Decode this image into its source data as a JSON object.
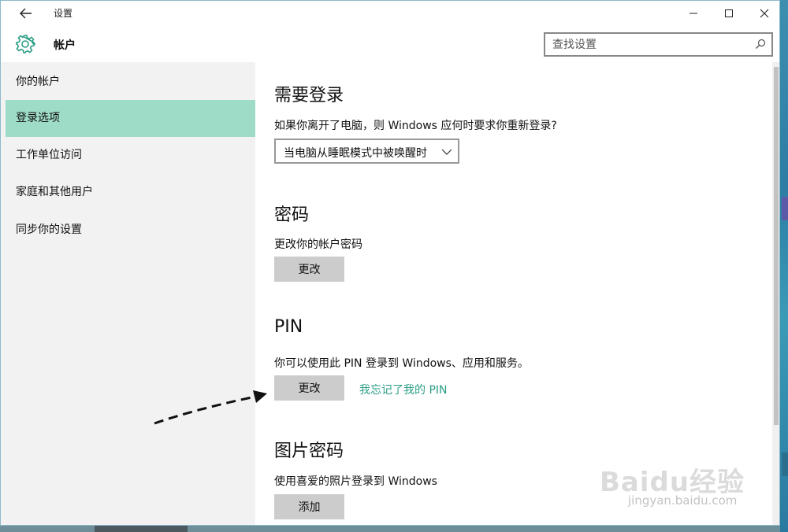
{
  "window": {
    "title": "设置",
    "section": "帐户",
    "search_placeholder": "查找设置"
  },
  "sidebar": {
    "items": [
      {
        "label": "你的帐户"
      },
      {
        "label": "登录选项"
      },
      {
        "label": "工作单位访问"
      },
      {
        "label": "家庭和其他用户"
      },
      {
        "label": "同步你的设置"
      }
    ],
    "active_index": 1
  },
  "main": {
    "require_signin": {
      "heading": "需要登录",
      "description": "如果你离开了电脑，则 Windows 应何时要求你重新登录?",
      "dropdown_value": "当电脑从睡眠模式中被唤醒时"
    },
    "password": {
      "heading": "密码",
      "description": "更改你的帐户密码",
      "button": "更改"
    },
    "pin": {
      "heading": "PIN",
      "description": "你可以使用此 PIN 登录到 Windows、应用和服务。",
      "button": "更改",
      "link": "我忘记了我的 PIN"
    },
    "picture_password": {
      "heading": "图片密码",
      "description": "使用喜爱的照片登录到 Windows",
      "button": "添加"
    }
  },
  "watermark": {
    "brand": "Baidu经验",
    "url": "jingyan.baidu.com"
  },
  "colors": {
    "active_nav": "#9fdcc7",
    "link": "#2b9e85",
    "button": "#cccccc"
  }
}
